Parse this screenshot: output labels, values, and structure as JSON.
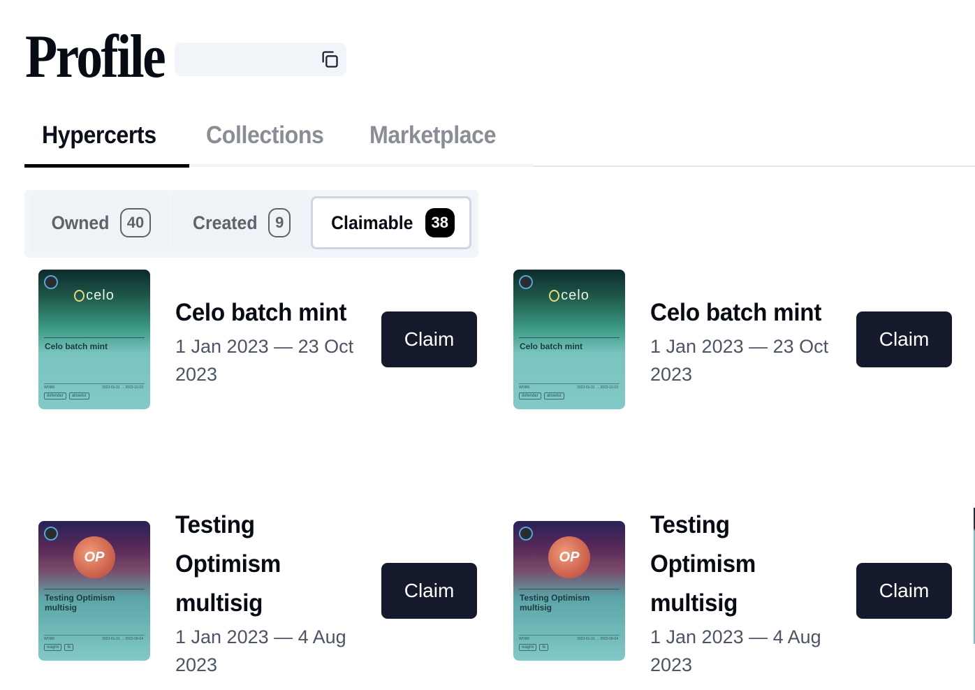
{
  "header": {
    "title": "Profile",
    "address_value": "",
    "copy_icon": "copy-icon"
  },
  "tabs": [
    {
      "label": "Hypercerts",
      "active": true
    },
    {
      "label": "Collections",
      "active": false
    },
    {
      "label": "Marketplace",
      "active": false
    }
  ],
  "subtabs": [
    {
      "label": "Owned",
      "count": "40",
      "active": false
    },
    {
      "label": "Created",
      "count": "9",
      "active": false
    },
    {
      "label": "Claimable",
      "count": "38",
      "active": true
    }
  ],
  "cards": [
    {
      "name": "Celo batch mint",
      "dates": "1 Jan 2023 — 23 Oct 2023",
      "button": "Claim",
      "thumbnail": {
        "brand": "celo",
        "title": "Celo batch mint",
        "work_label": "WORK",
        "date_range": "2023-01-01 → 2023-10-23",
        "tags": [
          "defender",
          "allowlist"
        ]
      }
    },
    {
      "name": "Celo batch mint",
      "dates": "1 Jan 2023 — 23 Oct 2023",
      "button": "Claim",
      "thumbnail": {
        "brand": "celo",
        "title": "Celo batch mint",
        "work_label": "WORK",
        "date_range": "2023-01-01 → 2023-10-23",
        "tags": [
          "defender",
          "allowlist"
        ]
      }
    },
    {
      "name": "Testing Optimism multisig",
      "dates": "1 Jan 2023 — 4 Aug 2023",
      "button": "Claim",
      "thumbnail": {
        "brand": "OP",
        "title": "Testing Optimism multisig",
        "work_label": "WORK",
        "date_range": "2023-01-01 → 2023-08-04",
        "tags": [
          "wagmi",
          "fe"
        ]
      }
    },
    {
      "name": "Testing Optimism multisig",
      "dates": "1 Jan 2023 — 4 Aug 2023",
      "button": "Claim",
      "thumbnail": {
        "brand": "OP",
        "title": "Testing Optimism multisig",
        "work_label": "WORK",
        "date_range": "2023-01-01 → 2023-08-04",
        "tags": [
          "wagmi",
          "fe"
        ]
      }
    }
  ],
  "colors": {
    "primary_button": "#141a2b",
    "active_tab": "#0b0f19",
    "inactive_tab": "#898d96",
    "date_text": "#4b5565",
    "subtab_bg": "#f1f4f9"
  }
}
